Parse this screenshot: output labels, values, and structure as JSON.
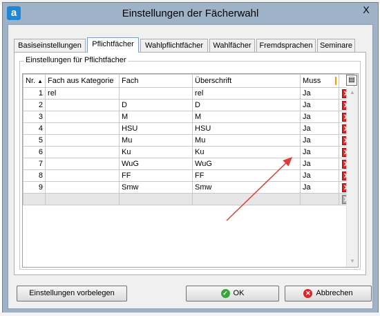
{
  "window": {
    "title": "Einstellungen der Fächerwahl",
    "app_icon": "a",
    "close_label": "X"
  },
  "tabs": [
    {
      "label": "Basiseinstellungen",
      "active": false
    },
    {
      "label": "Pflichtfächer",
      "active": true
    },
    {
      "label": "Wahlpflichtfächer",
      "active": false
    },
    {
      "label": "Wahlfächer",
      "active": false
    },
    {
      "label": "Fremdsprachen",
      "active": false
    },
    {
      "label": "Seminare",
      "active": false
    }
  ],
  "group": {
    "legend": "Einstellungen für Pflichtfächer"
  },
  "grid": {
    "columns": [
      "Nr.",
      "Fach aus Kategorie",
      "Fach",
      "Überschrift",
      "Muss"
    ],
    "rows": [
      {
        "nr": "1",
        "kategorie": "rel",
        "fach": "",
        "ueberschrift": "rel",
        "muss": "Ja"
      },
      {
        "nr": "2",
        "kategorie": "",
        "fach": "D",
        "ueberschrift": "D",
        "muss": "Ja"
      },
      {
        "nr": "3",
        "kategorie": "",
        "fach": "M",
        "ueberschrift": "M",
        "muss": "Ja"
      },
      {
        "nr": "4",
        "kategorie": "",
        "fach": "HSU",
        "ueberschrift": "HSU",
        "muss": "Ja"
      },
      {
        "nr": "5",
        "kategorie": "",
        "fach": "Mu",
        "ueberschrift": "Mu",
        "muss": "Ja"
      },
      {
        "nr": "6",
        "kategorie": "",
        "fach": "Ku",
        "ueberschrift": "Ku",
        "muss": "Ja"
      },
      {
        "nr": "7",
        "kategorie": "",
        "fach": "WuG",
        "ueberschrift": "WuG",
        "muss": "Ja"
      },
      {
        "nr": "8",
        "kategorie": "",
        "fach": "FF",
        "ueberschrift": "FF",
        "muss": "Ja"
      },
      {
        "nr": "9",
        "kategorie": "",
        "fach": "Smw",
        "ueberschrift": "Smw",
        "muss": "Ja"
      }
    ],
    "sort_icon": "sort-ascending-icon",
    "delete_icon": "delete-x-icon"
  },
  "buttons": {
    "preset": "Einstellungen vorbelegen",
    "ok": "OK",
    "cancel": "Abbrechen"
  },
  "colors": {
    "window_frame": "#9fb3c8",
    "delete_red": "#d8262b",
    "ok_green": "#3aa63a",
    "annotation_arrow": "#e03b3b"
  }
}
